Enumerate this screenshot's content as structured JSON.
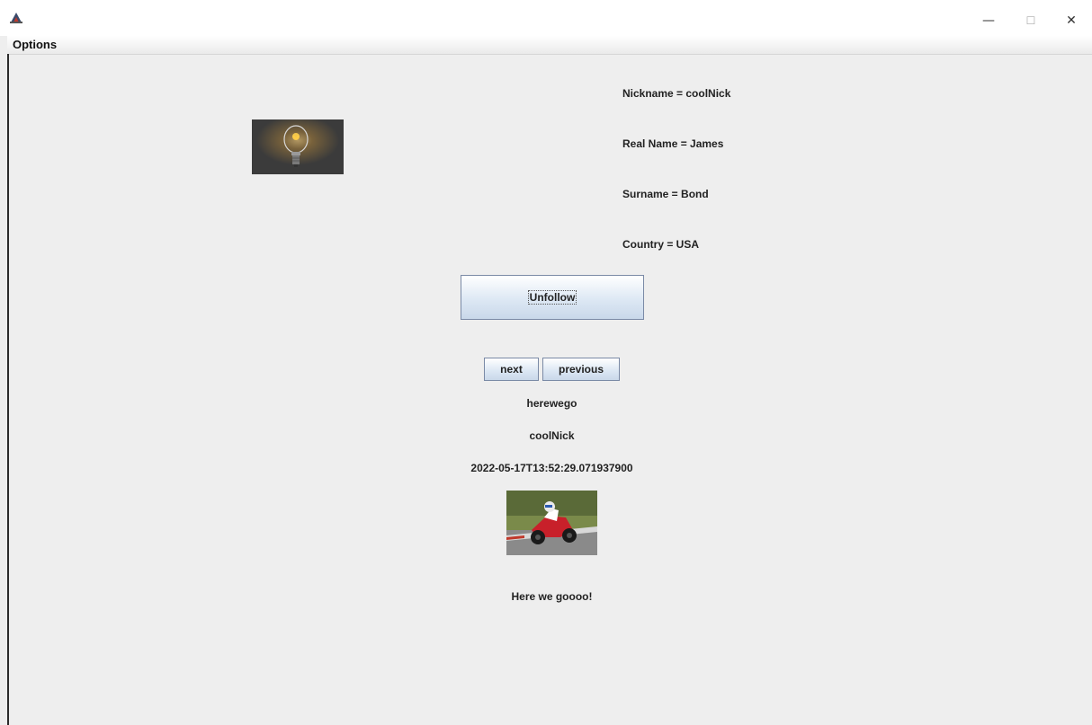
{
  "window": {
    "controls": {
      "minimize": "—",
      "maximize": "☐",
      "close": "✕"
    },
    "app_icon": "java-icon"
  },
  "menu": {
    "options_label": "Options"
  },
  "profile": {
    "nickname": "Nickname = coolNick",
    "real_name": "Real Name = James",
    "surname": "Surname = Bond",
    "country": "Country = USA"
  },
  "buttons": {
    "unfollow": "Unfollow",
    "next": "next",
    "previous": "previous"
  },
  "post": {
    "title": "herewego",
    "author": "coolNick",
    "timestamp": "2022-05-17T13:52:29.071937900",
    "text": "Here we goooo!"
  },
  "images": {
    "profile_picture": "lightbulb-image",
    "post_image": "motorcycle-image"
  }
}
